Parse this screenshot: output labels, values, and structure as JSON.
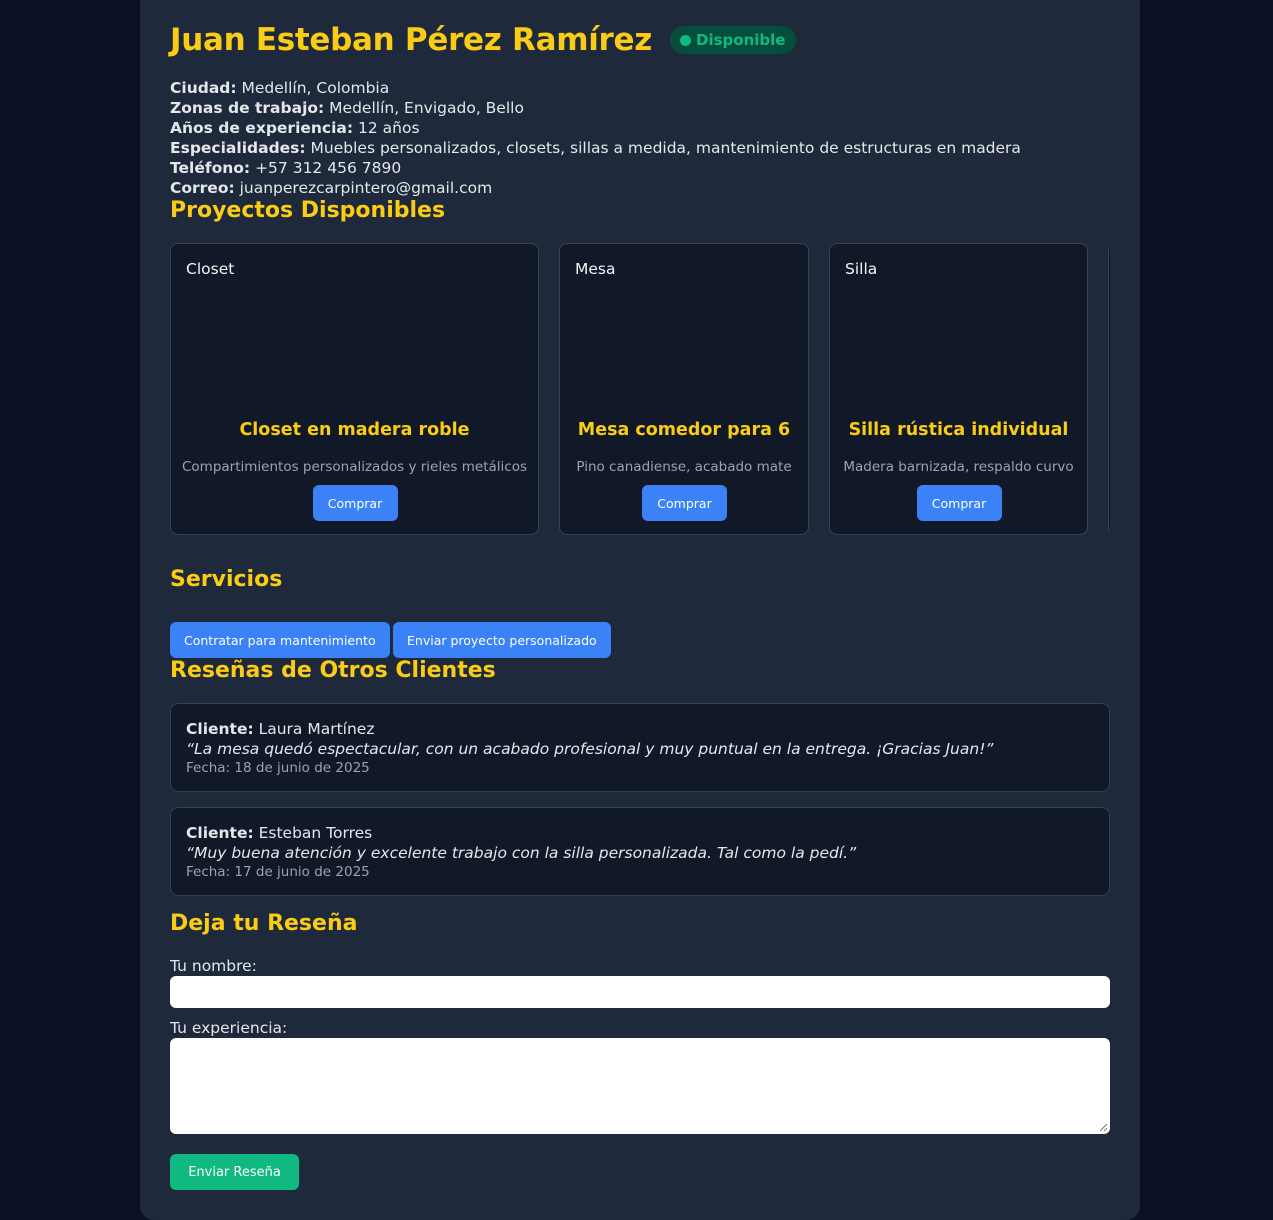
{
  "profile": {
    "name": "Juan Esteban Pérez Ramírez",
    "status": "Disponible",
    "status_color": "#10b981",
    "ciudad_label": "Ciudad:",
    "ciudad": " Medellín, Colombia",
    "zonas_label": "Zonas de trabajo:",
    "zonas": " Medellín, Envigado, Bello",
    "experiencia_label": "Años de experiencia:",
    "experiencia": " 12 años",
    "especialidades_label": "Especialidades:",
    "especialidades": " Muebles personalizados, closets, sillas a medida, mantenimiento de estructuras en madera",
    "telefono_label": "Teléfono:",
    "telefono": " +57 312 456 7890",
    "correo_label": "Correo:",
    "correo": " juanperezcarpintero@gmail.com"
  },
  "projects": {
    "title": "Proyectos Disponibles",
    "items": [
      {
        "image_alt": "Closet",
        "title": "Closet en madera roble",
        "desc": "Compartimientos personalizados y rieles metálicos",
        "button": "Comprar"
      },
      {
        "image_alt": "Mesa",
        "title": "Mesa comedor para 6",
        "desc": "Pino canadiense, acabado mate",
        "button": "Comprar"
      },
      {
        "image_alt": "Silla",
        "title": "Silla rústica individual",
        "desc": "Madera barnizada, respaldo curvo",
        "button": "Comprar"
      }
    ]
  },
  "services": {
    "title": "Servicios",
    "maintenance_button": "Contratar para mantenimiento",
    "custom_button": "Enviar proyecto personalizado"
  },
  "reviews": {
    "title": "Reseñas de Otros Clientes",
    "client_label": "Cliente:",
    "items": [
      {
        "client": " Laura Martínez",
        "quote": "“La mesa quedó espectacular, con un acabado profesional y muy puntual en la entrega. ¡Gracias Juan!”",
        "date": "Fecha: 18 de junio de 2025"
      },
      {
        "client": " Esteban Torres",
        "quote": "“Muy buena atención y excelente trabajo con la silla personalizada. Tal como la pedí.”",
        "date": "Fecha: 17 de junio de 2025"
      }
    ]
  },
  "form": {
    "title": "Deja tu Reseña",
    "name_label": "Tu nombre:",
    "name_value": "",
    "experience_label": "Tu experiencia:",
    "experience_value": "",
    "submit": "Enviar Reseña"
  },
  "colors": {
    "accent": "#facc15",
    "primary_button": "#3b82f6",
    "submit_button": "#10b981",
    "panel": "#1e293b",
    "card": "#111827"
  }
}
